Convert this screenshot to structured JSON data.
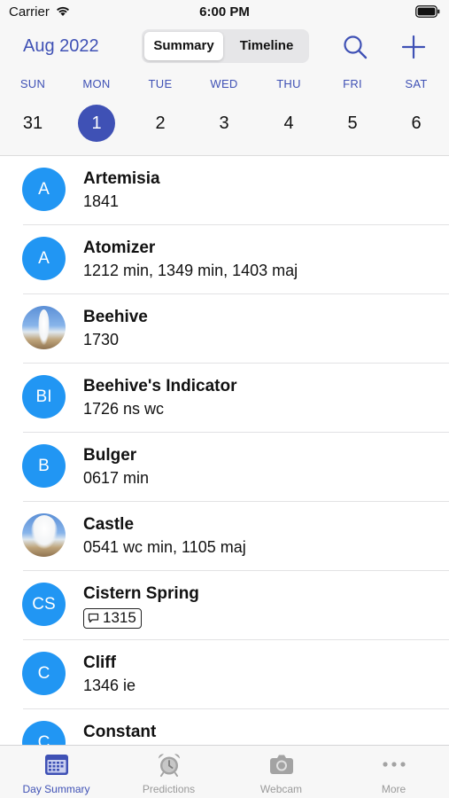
{
  "status_bar": {
    "carrier": "Carrier",
    "time": "6:00 PM"
  },
  "header": {
    "month": "Aug 2022",
    "segments": [
      "Summary",
      "Timeline"
    ],
    "selected_segment": "Summary",
    "weekdays": [
      "SUN",
      "MON",
      "TUE",
      "WED",
      "THU",
      "FRI",
      "SAT"
    ],
    "dates": [
      "31",
      "1",
      "2",
      "3",
      "4",
      "5",
      "6"
    ],
    "selected_date": "1",
    "accent_color": "#3f51b5"
  },
  "list": {
    "avatar_color": "#2196f3",
    "items": [
      {
        "name": "Artemisia",
        "avatar": "A",
        "detail": "1841"
      },
      {
        "name": "Atomizer",
        "avatar": "A",
        "detail": "1212 min, 1349 min, 1403 maj"
      },
      {
        "name": "Beehive",
        "avatar": "photo",
        "detail": "1730"
      },
      {
        "name": "Beehive's Indicator",
        "avatar": "BI",
        "detail": "1726 ns wc"
      },
      {
        "name": "Bulger",
        "avatar": "B",
        "detail": "0617 min"
      },
      {
        "name": "Castle",
        "avatar": "photo",
        "detail": "0541 wc min, 1105 maj"
      },
      {
        "name": "Cistern Spring",
        "avatar": "CS",
        "detail": "1315",
        "detail_style": "comment-badge"
      },
      {
        "name": "Cliff",
        "avatar": "C",
        "detail": "1346 ie"
      },
      {
        "name": "Constant",
        "avatar": "C",
        "detail": ""
      }
    ]
  },
  "tabbar": {
    "tabs": [
      {
        "label": "Day Summary",
        "icon": "calendar-icon",
        "active": true
      },
      {
        "label": "Predictions",
        "icon": "alarm-clock-icon",
        "active": false
      },
      {
        "label": "Webcam",
        "icon": "camera-icon",
        "active": false
      },
      {
        "label": "More",
        "icon": "more-dots-icon",
        "active": false
      }
    ]
  }
}
